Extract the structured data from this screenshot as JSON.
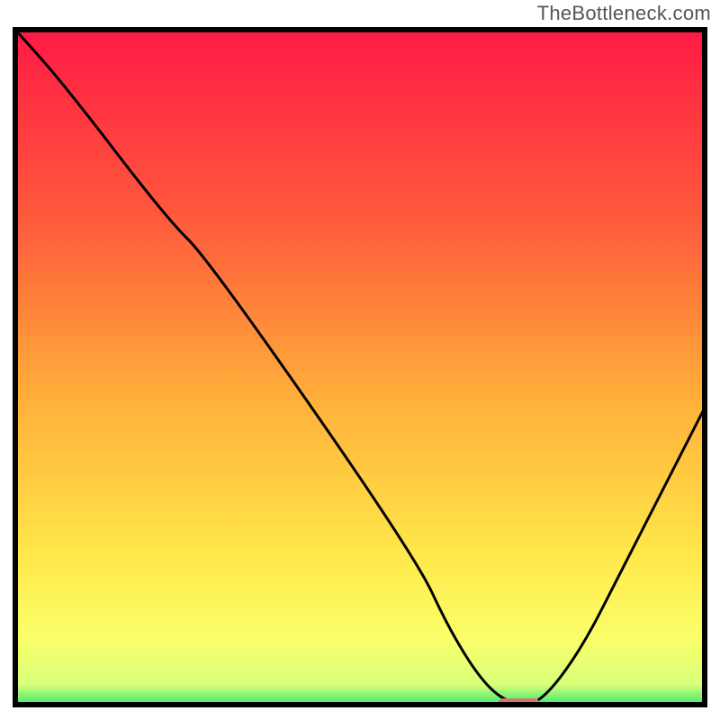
{
  "watermark": "TheBottleneck.com",
  "chart_data": {
    "type": "line",
    "title": "",
    "xlabel": "",
    "ylabel": "",
    "xlim": [
      0,
      100
    ],
    "ylim": [
      0,
      100
    ],
    "grid": false,
    "legend": false,
    "gradient_stops": [
      {
        "offset": 0,
        "color": "#ff1a44"
      },
      {
        "offset": 28,
        "color": "#ff5a3c"
      },
      {
        "offset": 55,
        "color": "#ffb03a"
      },
      {
        "offset": 78,
        "color": "#ffe84a"
      },
      {
        "offset": 90,
        "color": "#fbff6a"
      },
      {
        "offset": 97,
        "color": "#d8ff7a"
      },
      {
        "offset": 100,
        "color": "#3ee86f"
      }
    ],
    "series": [
      {
        "name": "bottleneck-curve",
        "x": [
          0,
          7,
          22,
          28,
          58,
          63,
          68,
          72,
          76,
          82,
          88,
          94,
          100
        ],
        "values": [
          100,
          92,
          72,
          66,
          22,
          11,
          3,
          0,
          0,
          8,
          20,
          32,
          44
        ]
      }
    ],
    "marker": {
      "name": "optimal-range",
      "x_range": [
        70,
        76
      ],
      "y": 0.2,
      "color": "#d6756e"
    },
    "baseline": {
      "y": 0,
      "stroke": "#000000",
      "width": 3
    },
    "frame": {
      "stroke": "#000000",
      "width": 6
    }
  }
}
